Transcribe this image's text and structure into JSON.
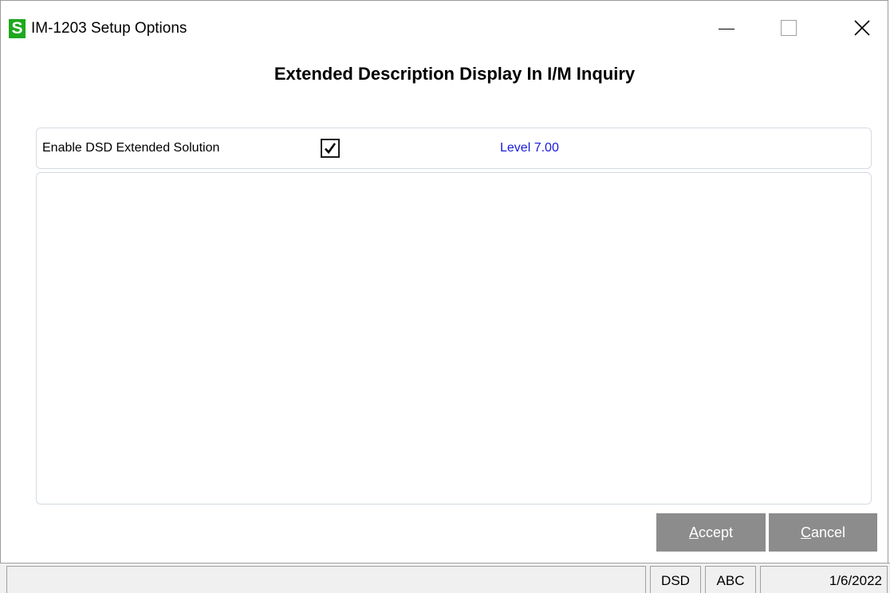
{
  "window": {
    "title": "IM-1203  Setup Options",
    "app_icon_letter": "S",
    "app_icon_color": "#1ea81e",
    "controls": [
      "minimize-icon",
      "maximize-icon",
      "close-icon"
    ]
  },
  "form": {
    "heading": "Extended Description Display In I/M Inquiry",
    "option": {
      "label": "Enable DSD Extended Solution",
      "checked": true,
      "level": "Level  7.00",
      "level_color": "#1a1adc"
    }
  },
  "buttons": {
    "accept": {
      "mnemonic": "A",
      "rest": "ccept"
    },
    "cancel": {
      "mnemonic": "C",
      "rest": "ancel"
    },
    "color": "#8c8c8c"
  },
  "statusbar": {
    "message": "",
    "company": "DSD",
    "user": "ABC",
    "date": "1/6/2022"
  }
}
